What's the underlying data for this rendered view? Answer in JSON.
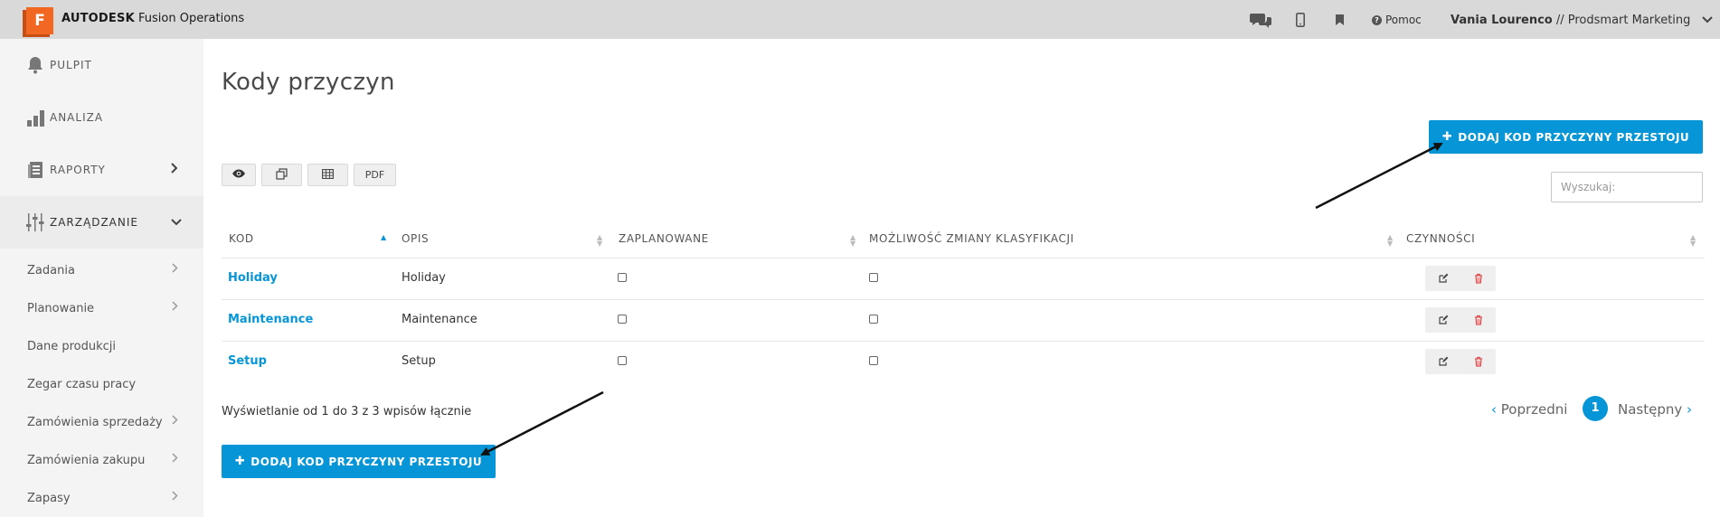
{
  "header": {
    "logo_letter": "F",
    "brand_bold": "AUTODESK",
    "brand_rest": " Fusion Operations",
    "help_label": "Pomoc",
    "user_name": "Vania Lourenco",
    "user_separator": " // ",
    "company": "Prodsmart Marketing",
    "icons": [
      "chat-icon",
      "mobile-icon",
      "bookmark-icon",
      "help-icon",
      "chevron-down-icon"
    ]
  },
  "sidebar": {
    "main": [
      {
        "label": "PULPIT",
        "icon": "bell-icon"
      },
      {
        "label": "ANALIZA",
        "icon": "bar-chart-icon"
      },
      {
        "label": "RAPORTY",
        "icon": "report-icon"
      },
      {
        "label": "ZARZĄDZANIE",
        "icon": "sliders-icon"
      }
    ],
    "sub": [
      {
        "label": "Zadania"
      },
      {
        "label": "Planowanie"
      },
      {
        "label": "Dane produkcji"
      },
      {
        "label": "Zegar czasu pracy"
      },
      {
        "label": "Zamówienia sprzedaży"
      },
      {
        "label": "Zamówienia zakupu"
      },
      {
        "label": "Zapasy"
      }
    ]
  },
  "page": {
    "title": "Kody przyczyn",
    "add_button_label": "DODAJ KOD PRZYCZYNY PRZESTOJU",
    "search_placeholder": "Wyszukaj:",
    "toolbar": {
      "pdf_label": "PDF"
    }
  },
  "table": {
    "columns": [
      "KOD",
      "OPIS",
      "ZAPLANOWANE",
      "MOŻLIWOŚĆ ZMIANY KLASYFIKACJI",
      "CZYNNOŚCI"
    ],
    "rows": [
      {
        "kod": "Holiday",
        "opis": "Holiday",
        "zaplanowane": false,
        "zmiana": false
      },
      {
        "kod": "Maintenance",
        "opis": "Maintenance",
        "zaplanowane": false,
        "zmiana": false
      },
      {
        "kod": "Setup",
        "opis": "Setup",
        "zaplanowane": false,
        "zmiana": false
      }
    ],
    "info": "Wyświetlanie od 1 do 3 z 3 wpisów łącznie"
  },
  "pagination": {
    "prev_label": "Poprzedni",
    "current": "1",
    "next_label": "Następny"
  },
  "colors": {
    "accent": "#0696d7",
    "brand_orange": "#f26722",
    "delete_red": "#e05050"
  }
}
